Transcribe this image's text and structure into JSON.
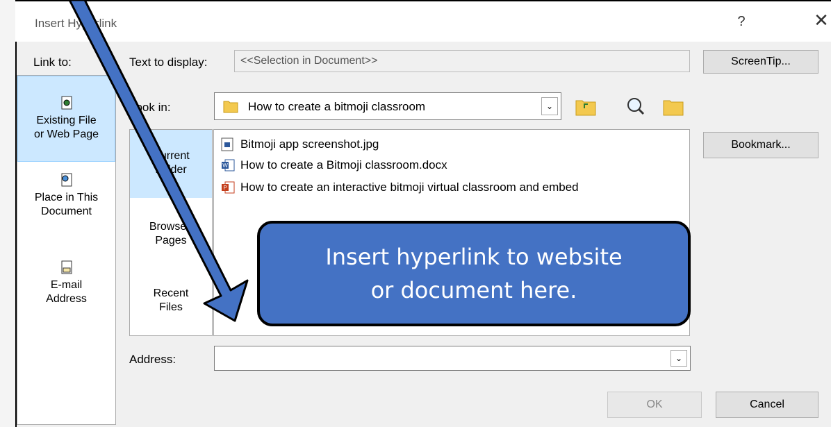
{
  "window": {
    "title": "Insert Hyperlink",
    "help_label": "?",
    "close_label": "✕"
  },
  "link_to": {
    "heading": "Link to:",
    "items": [
      {
        "label_line1": "Existing File",
        "label_line2": "or Web Page",
        "icon": "existing-file-icon",
        "selected": true
      },
      {
        "label_line1": "Place in This",
        "label_line2": "Document",
        "icon": "place-in-document-icon",
        "selected": false
      },
      {
        "label_line1": "E-mail",
        "label_line2": "Address",
        "icon": "email-address-icon",
        "selected": false
      }
    ]
  },
  "text_to_display": {
    "label": "Text to display:",
    "value": "<<Selection in Document>>"
  },
  "buttons": {
    "screentip": "ScreenTip...",
    "bookmark": "Bookmark...",
    "ok": "OK",
    "cancel": "Cancel"
  },
  "look_in": {
    "label": "Look in:",
    "value": "How to create a bitmoji classroom"
  },
  "subnav": [
    {
      "line1": "Current",
      "line2": "Folder",
      "selected": true
    },
    {
      "line1": "Browsed",
      "line2": "Pages",
      "selected": false
    },
    {
      "line1": "Recent",
      "line2": "Files",
      "selected": false
    }
  ],
  "files": [
    {
      "name": "Bitmoji app screenshot.jpg",
      "icon": "image-file-icon"
    },
    {
      "name": "How to create a Bitmoji classroom.docx",
      "icon": "word-file-icon"
    },
    {
      "name": "How to create an interactive bitmoji virtual classroom and embed",
      "icon": "powerpoint-file-icon"
    }
  ],
  "address": {
    "label": "Address:",
    "value": ""
  },
  "callout": {
    "line1": "Insert hyperlink to website",
    "line2": "or document here."
  },
  "colors": {
    "callout_fill": "#4472c4",
    "arrow_fill": "#4472c4",
    "selection": "#cce8ff"
  }
}
